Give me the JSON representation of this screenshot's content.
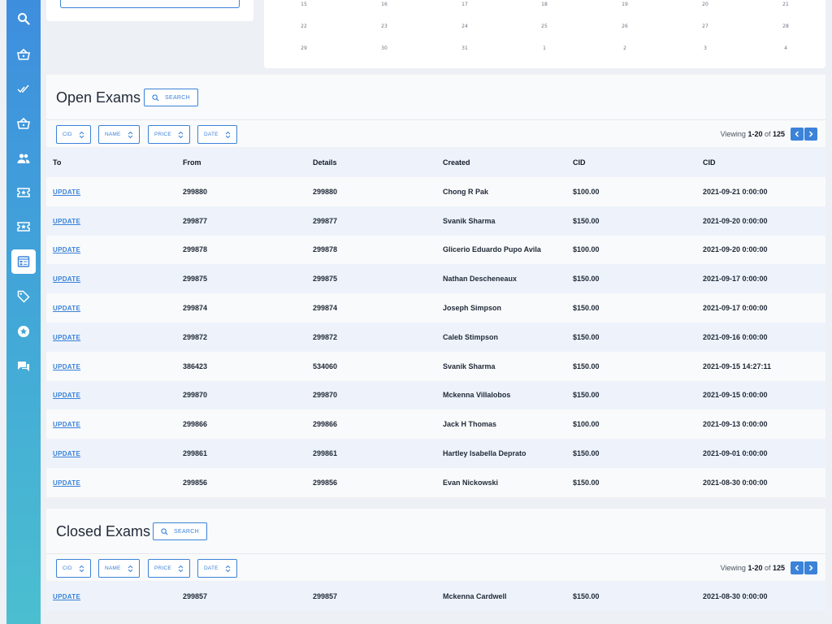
{
  "sidebar": {
    "icons": [
      "search-icon",
      "basket-icon",
      "double-check-icon",
      "basket-icon",
      "users-icon",
      "ticket-icon",
      "ticket-icon",
      "exam-list-icon",
      "tag-icon",
      "star-badge-icon",
      "chat-icon"
    ],
    "active_index": 7,
    "colors": {
      "top": "#3e8ede",
      "bottom": "#4bbfd0"
    }
  },
  "calendar": {
    "rows": [
      [
        "15",
        "16",
        "17",
        "18",
        "19",
        "20",
        "21"
      ],
      [
        "22",
        "23",
        "24",
        "25",
        "26",
        "27",
        "28"
      ],
      [
        "29",
        "30",
        "31",
        "1",
        "2",
        "3",
        "4"
      ]
    ]
  },
  "open_exams": {
    "title": "Open Exams",
    "search_label": "SEARCH",
    "filters": [
      "CID",
      "NAME",
      "PRICE",
      "DATE"
    ],
    "viewing_prefix": "Viewing ",
    "viewing_range": "1-20",
    "viewing_of": " of ",
    "viewing_total": "125",
    "columns": [
      "To",
      "From",
      "Details",
      "Created",
      "CID",
      "CID"
    ],
    "rows": [
      [
        "UPDATE",
        "299880",
        "299880",
        "Chong R Pak",
        "$100.00",
        "2021-09-21 0:00:00"
      ],
      [
        "UPDATE",
        "299877",
        "299877",
        "Svanik Sharma",
        "$150.00",
        "2021-09-20 0:00:00"
      ],
      [
        "UPDATE",
        "299878",
        "299878",
        "Glicerio Eduardo Pupo Avila",
        "$100.00",
        "2021-09-20 0:00:00"
      ],
      [
        "UPDATE",
        "299875",
        "299875",
        "Nathan Descheneaux",
        "$150.00",
        "2021-09-17 0:00:00"
      ],
      [
        "UPDATE",
        "299874",
        "299874",
        "Joseph Simpson",
        "$150.00",
        "2021-09-17 0:00:00"
      ],
      [
        "UPDATE",
        "299872",
        "299872",
        "Caleb Stimpson",
        "$150.00",
        "2021-09-16 0:00:00"
      ],
      [
        "UPDATE",
        "386423",
        "534060",
        "Svanik Sharma",
        "$150.00",
        "2021-09-15 14:27:11"
      ],
      [
        "UPDATE",
        "299870",
        "299870",
        "Mckenna Villalobos",
        "$150.00",
        "2021-09-15 0:00:00"
      ],
      [
        "UPDATE",
        "299866",
        "299866",
        "Jack H Thomas",
        "$100.00",
        "2021-09-13 0:00:00"
      ],
      [
        "UPDATE",
        "299861",
        "299861",
        "Hartley Isabella Deprato",
        "$150.00",
        "2021-09-01 0:00:00"
      ],
      [
        "UPDATE",
        "299856",
        "299856",
        "Evan Nickowski",
        "$150.00",
        "2021-08-30 0:00:00"
      ]
    ]
  },
  "closed_exams": {
    "title": "Closed Exams",
    "search_label": "SEARCH",
    "filters": [
      "CID",
      "NAME",
      "PRICE",
      "DATE"
    ],
    "viewing_prefix": "Viewing ",
    "viewing_range": "1-20",
    "viewing_of": " of ",
    "viewing_total": "125",
    "rows": [
      [
        "UPDATE",
        "299857",
        "299857",
        "Mckenna Cardwell",
        "$150.00",
        "2021-08-30 0:00:00"
      ]
    ]
  },
  "colors": {
    "accent": "#3b82d9",
    "row_alt": "#eef3fb"
  }
}
